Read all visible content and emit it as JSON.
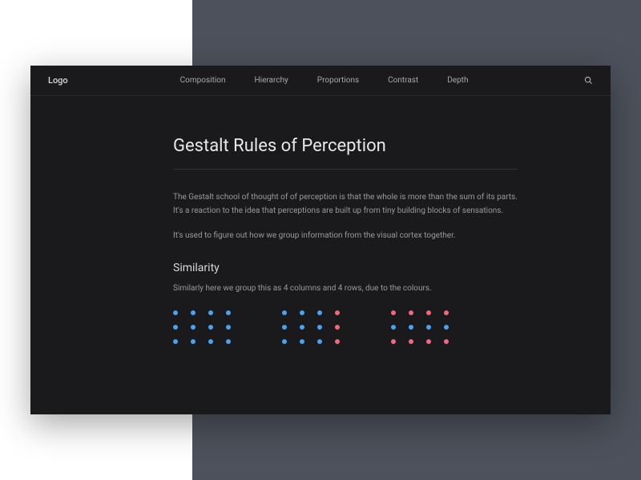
{
  "nav": {
    "logo": "Logo",
    "links": [
      "Composition",
      "Hierarchy",
      "Proportions",
      "Contrast",
      "Depth"
    ]
  },
  "article": {
    "title": "Gestalt Rules of Perception",
    "p1": "The Gestalt school of thought of of perception is that the whole is more than the sum of its parts. It's a reaction to the idea that perceptions are built up from tiny building blocks of sensations.",
    "p2": "It's used to figure out how we group information from the visual cortex together.",
    "section_title": "Similarity",
    "section_text": "Similarly here we group this as 4 columns and 4 rows, due to the colours."
  },
  "colors": {
    "blue": "#4aa3f0",
    "pink": "#f06a7a",
    "bg": "#1a1a1c"
  }
}
